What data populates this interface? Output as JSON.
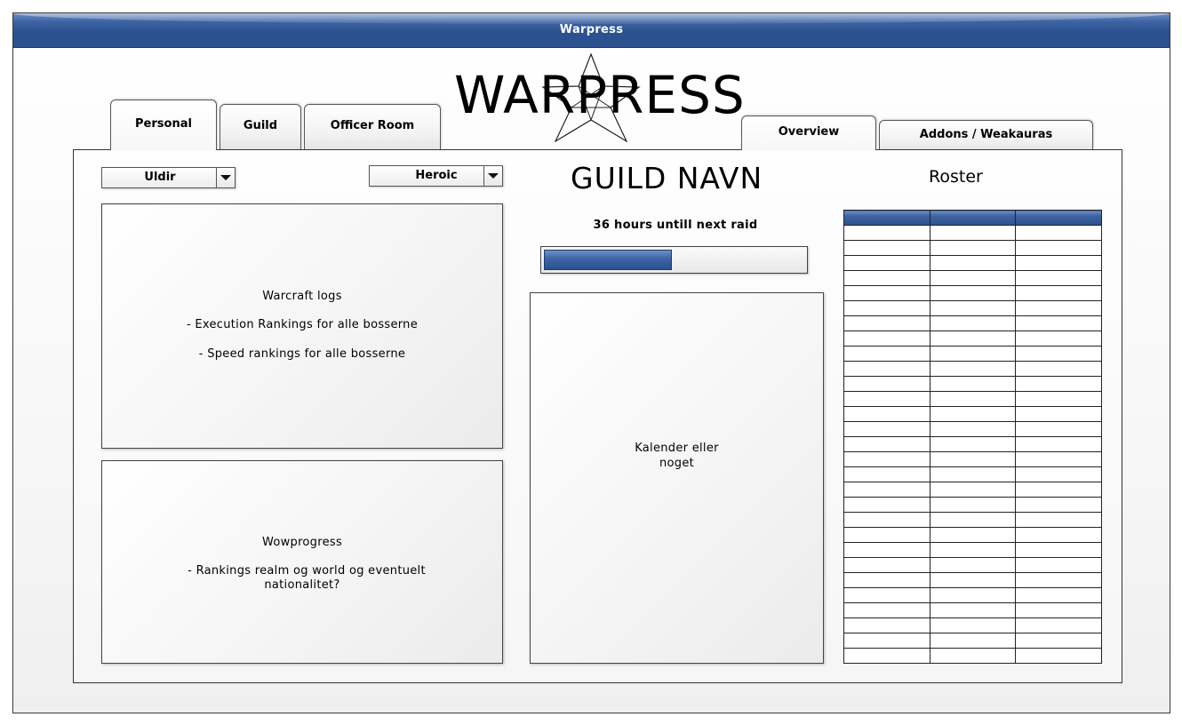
{
  "window": {
    "title": "Warpress"
  },
  "logo": {
    "text": "WARPRESS"
  },
  "left_tabs": [
    "Personal",
    "Guild",
    "Officer Room"
  ],
  "right_tabs": [
    "Overview",
    "Addons / Weakauras"
  ],
  "active_left_tab": "Personal",
  "active_right_tab": "Overview",
  "filters": {
    "raid": {
      "value": "Uldir"
    },
    "difficulty": {
      "value": "Heroic"
    }
  },
  "warcraft_logs": {
    "title": "Warcraft logs",
    "line1": "- Execution Rankings for alle bosserne",
    "line2": "- Speed rankings for alle bosserne"
  },
  "wowprogress": {
    "title": "Wowprogress",
    "line1": "- Rankings realm og world og eventuelt",
    "line2": "nationalitet?"
  },
  "guild": {
    "name": "GUILD NAVN"
  },
  "raid_timer": {
    "text": "36 hours untill next raid",
    "progress_fraction": 0.49
  },
  "calendar": {
    "line1": "Kalender eller",
    "line2": "noget"
  },
  "roster": {
    "title": "Roster",
    "columns": [
      "",
      "",
      ""
    ],
    "row_count": 29
  },
  "colors": {
    "accent": "#2c518f",
    "accent_light": "#6f8fc4",
    "border": "#333333"
  }
}
